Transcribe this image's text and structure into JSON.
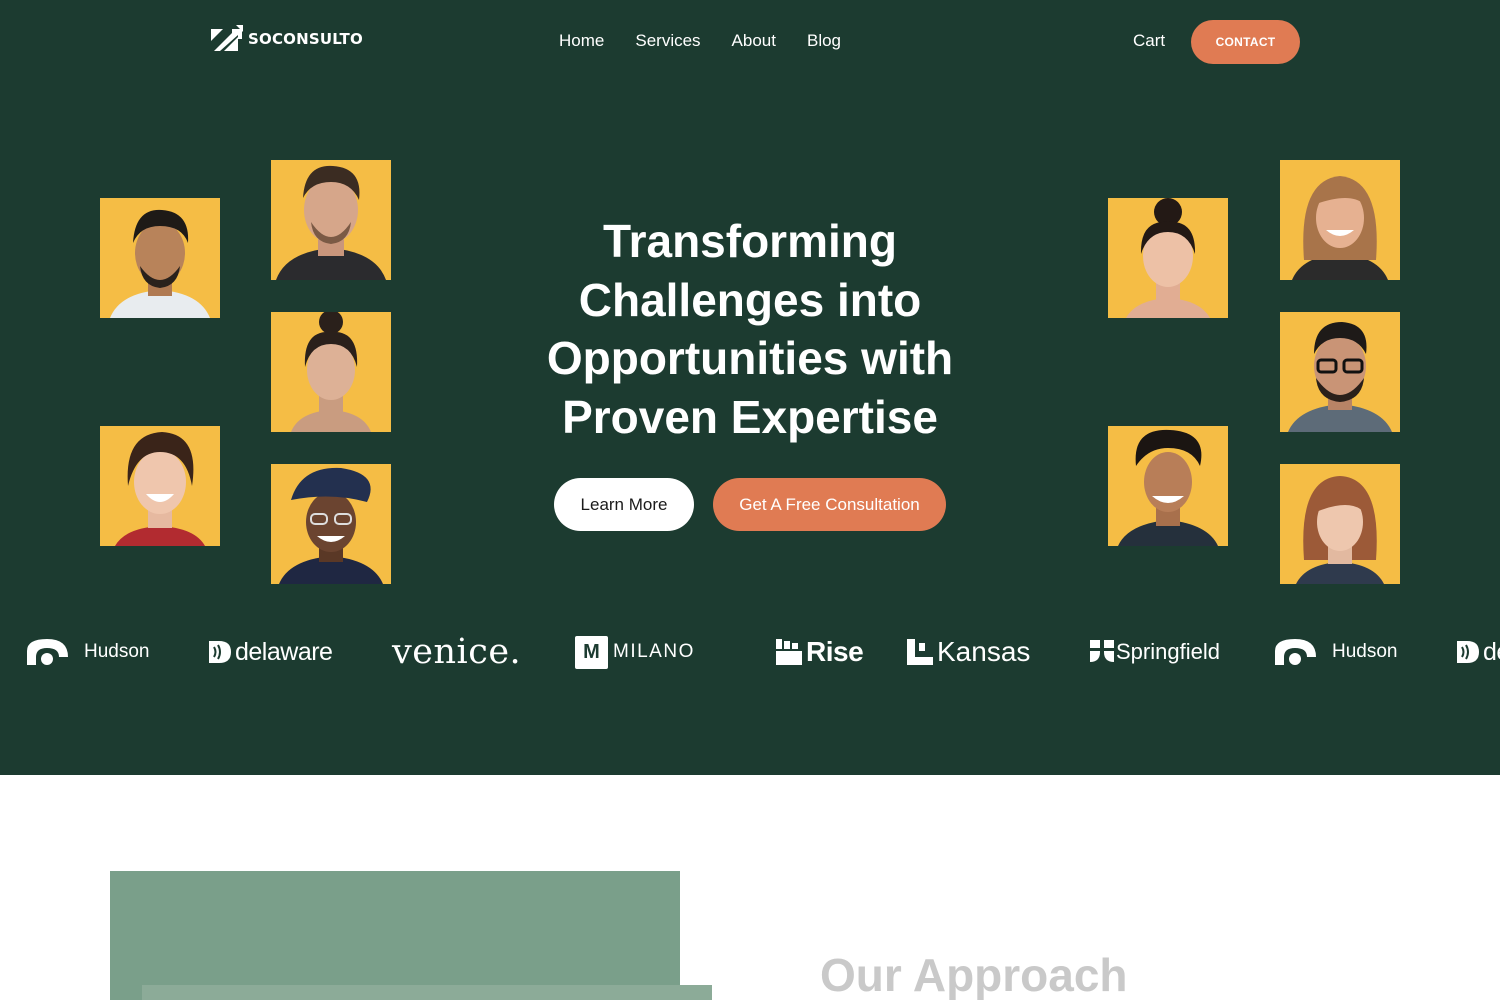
{
  "nav": {
    "logo_text": "SOCONSULTO",
    "links": [
      "Home",
      "Services",
      "About",
      "Blog"
    ],
    "cart_label": "Cart",
    "contact_label": "CONTACT"
  },
  "hero": {
    "headline_lines": [
      "Transforming",
      "Challenges into",
      "Opportunities with",
      "Proven Expertise"
    ],
    "learn_more_label": "Learn More",
    "consultation_label": "Get A Free Consultation"
  },
  "brands": [
    "Hudson",
    "delaware",
    "venice.",
    "MILANO",
    "Rise",
    "Kansas",
    "Springfield",
    "Hudson",
    "delaware"
  ],
  "milano_mark": "M",
  "approach": {
    "title": "Our Approach"
  },
  "colors": {
    "hero_bg": "#1c3b30",
    "accent": "#e07b53",
    "portrait_bg": "#f5bd45",
    "approach_image": "#7a9f8a"
  }
}
